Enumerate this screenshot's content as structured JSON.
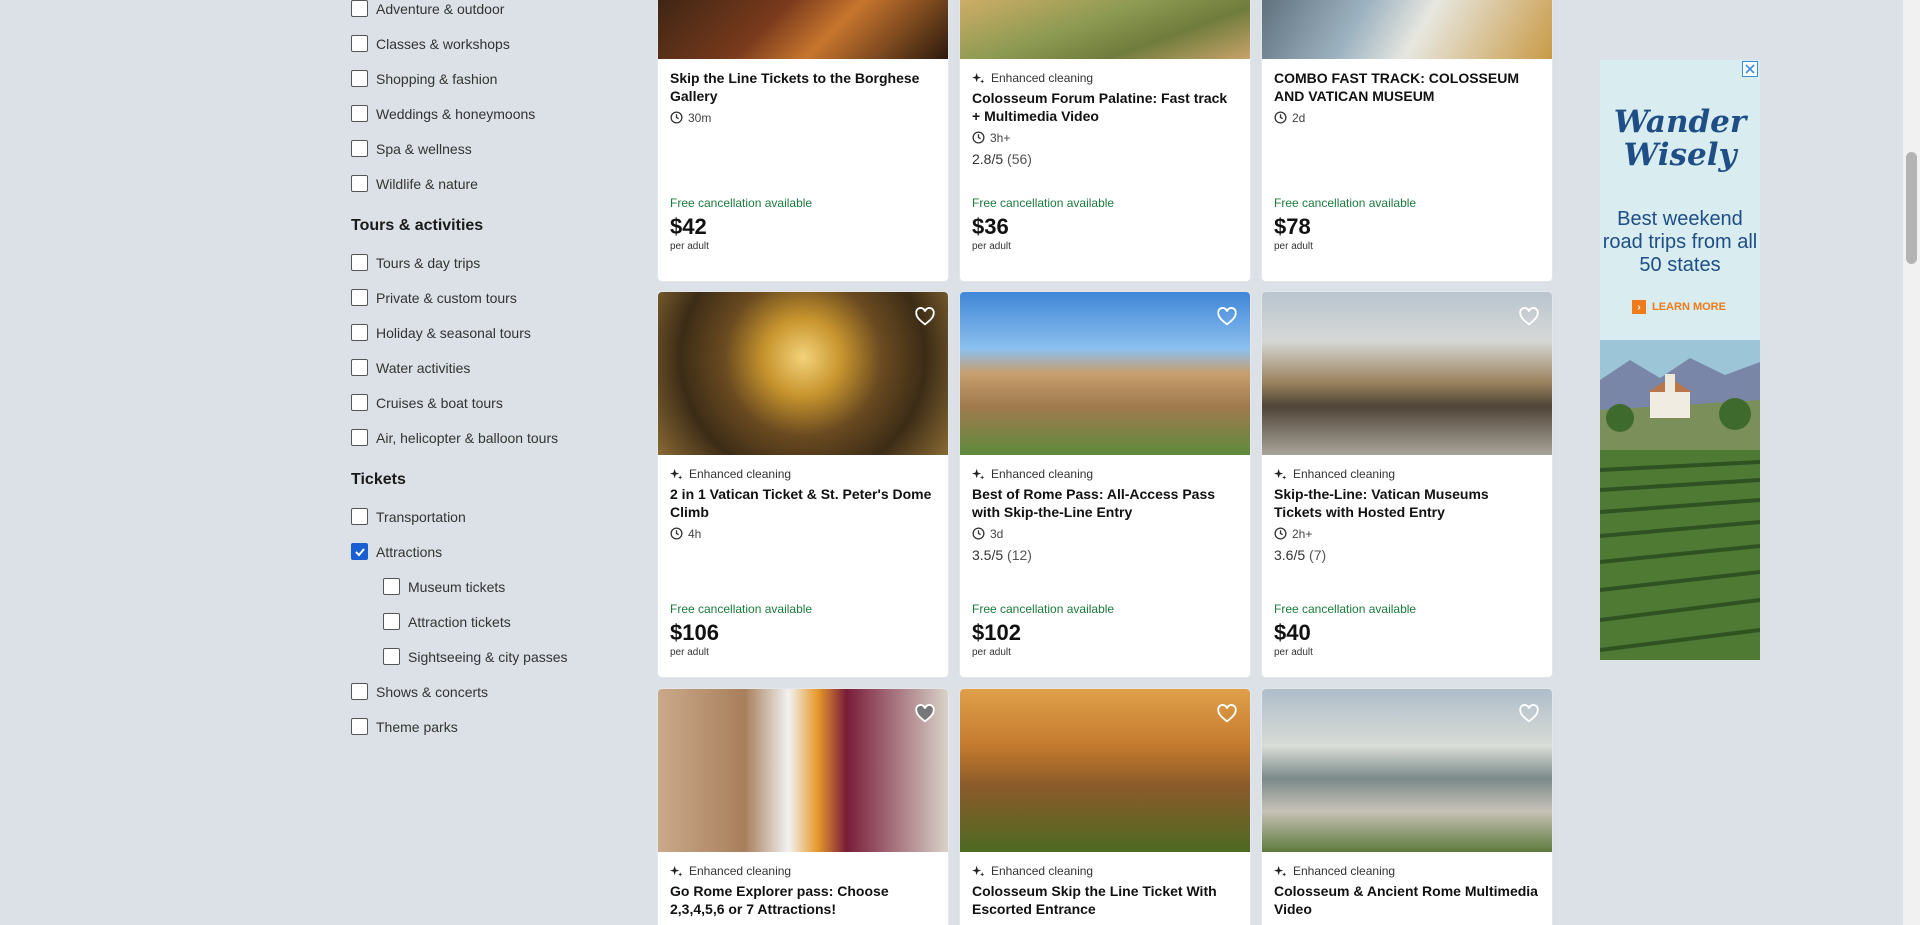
{
  "filters": {
    "top_items": [
      "Adventure & outdoor",
      "Classes & workshops",
      "Shopping & fashion",
      "Weddings & honeymoons",
      "Spa & wellness",
      "Wildlife & nature"
    ],
    "tours_title": "Tours & activities",
    "tours_items": [
      "Tours & day trips",
      "Private & custom tours",
      "Holiday & seasonal tours",
      "Water activities",
      "Cruises & boat tours",
      "Air, helicopter & balloon tours"
    ],
    "tickets_title": "Tickets",
    "tickets_items": {
      "transportation": "Transportation",
      "attractions": "Attractions",
      "attractions_checked": true,
      "museum": "Museum tickets",
      "attraction_tickets": "Attraction tickets",
      "sightseeing": "Sightseeing & city passes",
      "shows": "Shows & concerts",
      "theme_parks": "Theme parks"
    }
  },
  "cards": [
    {
      "title": "Skip the Line Tickets to the Borghese Gallery",
      "enhanced": "",
      "duration": "30m",
      "rating": "",
      "reviews": "",
      "free_cancel": "Free cancellation available",
      "price": "$42",
      "per": "per adult"
    },
    {
      "title": "Colosseum Forum Palatine: Fast track + Multimedia Video",
      "enhanced": "Enhanced cleaning",
      "duration": "3h+",
      "rating": "2.8/5",
      "reviews": "(56)",
      "free_cancel": "Free cancellation available",
      "price": "$36",
      "per": "per adult"
    },
    {
      "title": "COMBO FAST TRACK: COLOSSEUM AND VATICAN MUSEUM",
      "enhanced": "",
      "duration": "2d",
      "rating": "",
      "reviews": "",
      "free_cancel": "Free cancellation available",
      "price": "$78",
      "per": "per adult"
    },
    {
      "title": "2 in 1 Vatican Ticket & St. Peter's Dome Climb",
      "enhanced": "Enhanced cleaning",
      "duration": "4h",
      "rating": "",
      "reviews": "",
      "free_cancel": "Free cancellation available",
      "price": "$106",
      "per": "per adult"
    },
    {
      "title": "Best of Rome Pass: All-Access Pass with Skip-the-Line Entry",
      "enhanced": "Enhanced cleaning",
      "duration": "3d",
      "rating": "3.5/5",
      "reviews": "(12)",
      "free_cancel": "Free cancellation available",
      "price": "$102",
      "per": "per adult"
    },
    {
      "title": "Skip-the-Line: Vatican Museums Tickets with Hosted Entry",
      "enhanced": "Enhanced cleaning",
      "duration": "2h+",
      "rating": "3.6/5",
      "reviews": "(7)",
      "free_cancel": "Free cancellation available",
      "price": "$40",
      "per": "per adult"
    },
    {
      "title": "Go Rome Explorer pass: Choose 2,3,4,5,6 or 7 Attractions!",
      "enhanced": "Enhanced cleaning",
      "duration": "",
      "rating": "",
      "reviews": "",
      "free_cancel": "",
      "price": "",
      "per": ""
    },
    {
      "title": "Colosseum Skip the Line Ticket With Escorted Entrance",
      "enhanced": "Enhanced cleaning",
      "duration": "",
      "rating": "",
      "reviews": "",
      "free_cancel": "",
      "price": "",
      "per": ""
    },
    {
      "title": "Colosseum & Ancient Rome Multimedia Video",
      "enhanced": "Enhanced cleaning",
      "duration": "",
      "rating": "",
      "reviews": "",
      "free_cancel": "",
      "price": "",
      "per": ""
    }
  ],
  "ad": {
    "brand_line1": "Wander",
    "brand_line2": "Wisely",
    "tagline": "Best weekend road trips from all 50 states",
    "cta": "LEARN MORE"
  },
  "colors": {
    "accent": "#1a5fd1",
    "free_cancel": "#1b7a3c",
    "ad_brand": "#1e4e85",
    "ad_cta": "#f07b1a"
  }
}
